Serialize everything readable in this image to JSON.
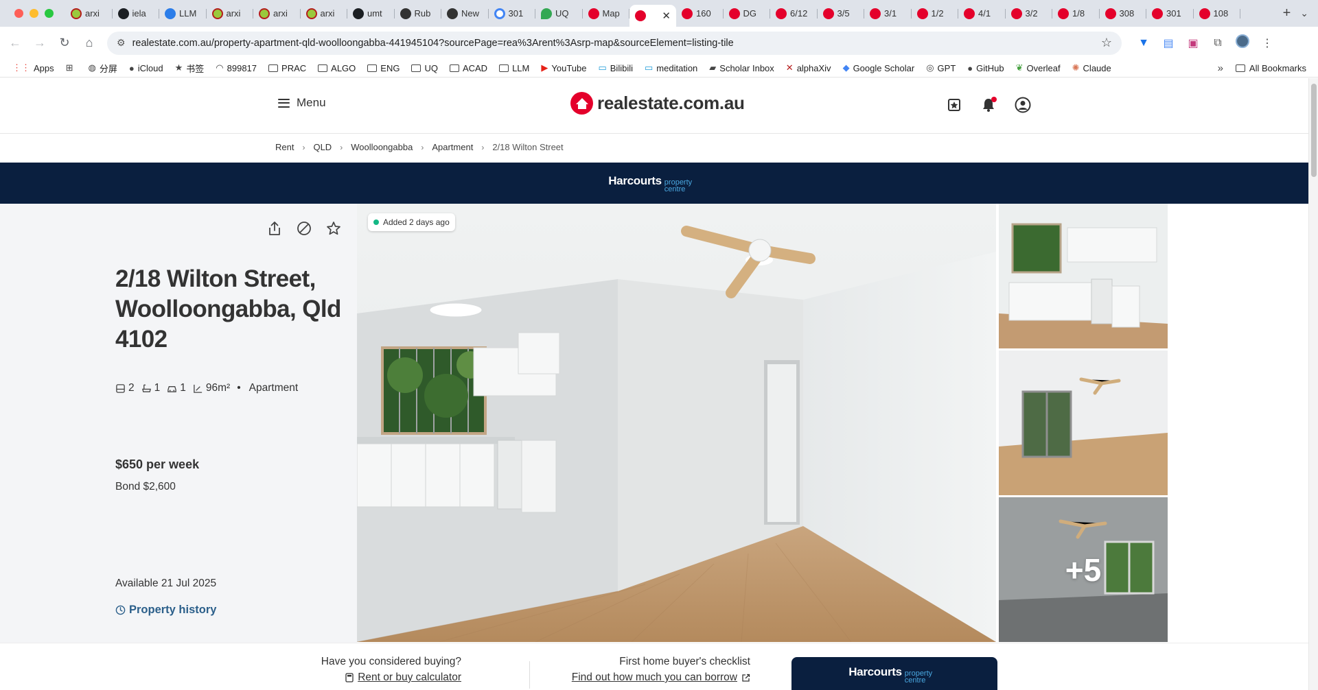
{
  "browser": {
    "tabs": [
      {
        "title": "arxi",
        "icon": "arxiv-icon"
      },
      {
        "title": "iela",
        "icon": "github-icon"
      },
      {
        "title": "LLM",
        "icon": "hat-icon"
      },
      {
        "title": "arxi",
        "icon": "arxiv-icon"
      },
      {
        "title": "arxi",
        "icon": "arxiv-icon"
      },
      {
        "title": "arxi",
        "icon": "arxiv-icon"
      },
      {
        "title": "umt",
        "icon": "github-icon"
      },
      {
        "title": "Rub",
        "icon": "chatgpt-icon"
      },
      {
        "title": "New",
        "icon": "globe-icon"
      },
      {
        "title": "301",
        "icon": "google-icon"
      },
      {
        "title": "UQ",
        "icon": "maps-icon"
      },
      {
        "title": "Map",
        "icon": "rea-icon"
      },
      {
        "title": "",
        "icon": "rea-icon",
        "active": true
      },
      {
        "title": "160",
        "icon": "rea-icon"
      },
      {
        "title": "DG",
        "icon": "rea-icon"
      },
      {
        "title": "6/12",
        "icon": "rea-icon"
      },
      {
        "title": "3/5",
        "icon": "rea-icon"
      },
      {
        "title": "3/1",
        "icon": "rea-icon"
      },
      {
        "title": "1/2",
        "icon": "rea-icon"
      },
      {
        "title": "4/1",
        "icon": "rea-icon"
      },
      {
        "title": "3/2",
        "icon": "rea-icon"
      },
      {
        "title": "1/8",
        "icon": "rea-icon"
      },
      {
        "title": "308",
        "icon": "rea-icon"
      },
      {
        "title": "301",
        "icon": "rea-icon"
      },
      {
        "title": "108",
        "icon": "rea-icon"
      }
    ],
    "url": "realestate.com.au/property-apartment-qld-woolloongabba-441945104?sourcePage=rea%3Arent%3Asrp-map&sourceElement=listing-tile",
    "bookmarks": [
      {
        "label": "Apps",
        "icon": "apps-grid-icon"
      },
      {
        "label": "",
        "icon": "grid-icon"
      },
      {
        "label": "分屏",
        "icon": "globe-icon"
      },
      {
        "label": "iCloud",
        "icon": "apple-icon"
      },
      {
        "label": "书签",
        "icon": "star-icon"
      },
      {
        "label": "899817",
        "icon": "wifi-icon"
      },
      {
        "label": "PRAC",
        "icon": "folder-icon"
      },
      {
        "label": "ALGO",
        "icon": "folder-icon"
      },
      {
        "label": "ENG",
        "icon": "folder-icon"
      },
      {
        "label": "UQ",
        "icon": "folder-icon"
      },
      {
        "label": "ACAD",
        "icon": "folder-icon"
      },
      {
        "label": "LLM",
        "icon": "folder-icon"
      },
      {
        "label": "YouTube",
        "icon": "youtube-icon"
      },
      {
        "label": "Bilibili",
        "icon": "bilibili-icon"
      },
      {
        "label": "meditation",
        "icon": "bilibili-icon"
      },
      {
        "label": "Scholar Inbox",
        "icon": "scholar-icon"
      },
      {
        "label": "alphaXiv",
        "icon": "alphaxiv-icon"
      },
      {
        "label": "Google Scholar",
        "icon": "google-scholar-icon"
      },
      {
        "label": "GPT",
        "icon": "chatgpt-icon"
      },
      {
        "label": "GitHub",
        "icon": "github-icon"
      },
      {
        "label": "Overleaf",
        "icon": "overleaf-icon"
      },
      {
        "label": "Claude",
        "icon": "claude-icon"
      }
    ],
    "bookmarks_more": "»",
    "all_bookmarks": "All Bookmarks"
  },
  "site": {
    "menu_label": "Menu",
    "logo_text": "realestate.com.au",
    "breadcrumb": [
      "Rent",
      "QLD",
      "Woolloongabba",
      "Apartment",
      "2/18 Wilton Street"
    ],
    "agency_brand": "Harcourts",
    "agency_sub": "property centre"
  },
  "listing": {
    "title": "2/18 Wilton Street, Woolloongabba, Qld 4102",
    "bedrooms": "2",
    "bathrooms": "1",
    "parking": "1",
    "land_size": "96m²",
    "separator": "•",
    "property_type": "Apartment",
    "price": "$650 per week",
    "bond": "Bond $2,600",
    "available": "Available 21 Jul 2025",
    "history_link": "Property history",
    "added_badge": "Added 2 days ago",
    "more_photos": "+5"
  },
  "bottom": {
    "buy_question": "Have you considered buying?",
    "buy_link": "Rent or buy calculator",
    "checklist_title": "First home buyer's checklist",
    "checklist_link": "Find out how much you can borrow"
  },
  "colors": {
    "brand_red": "#e4002b",
    "agency_navy": "#0a1f3f",
    "link_blue": "#2b5f8a",
    "badge_green": "#14b885"
  }
}
